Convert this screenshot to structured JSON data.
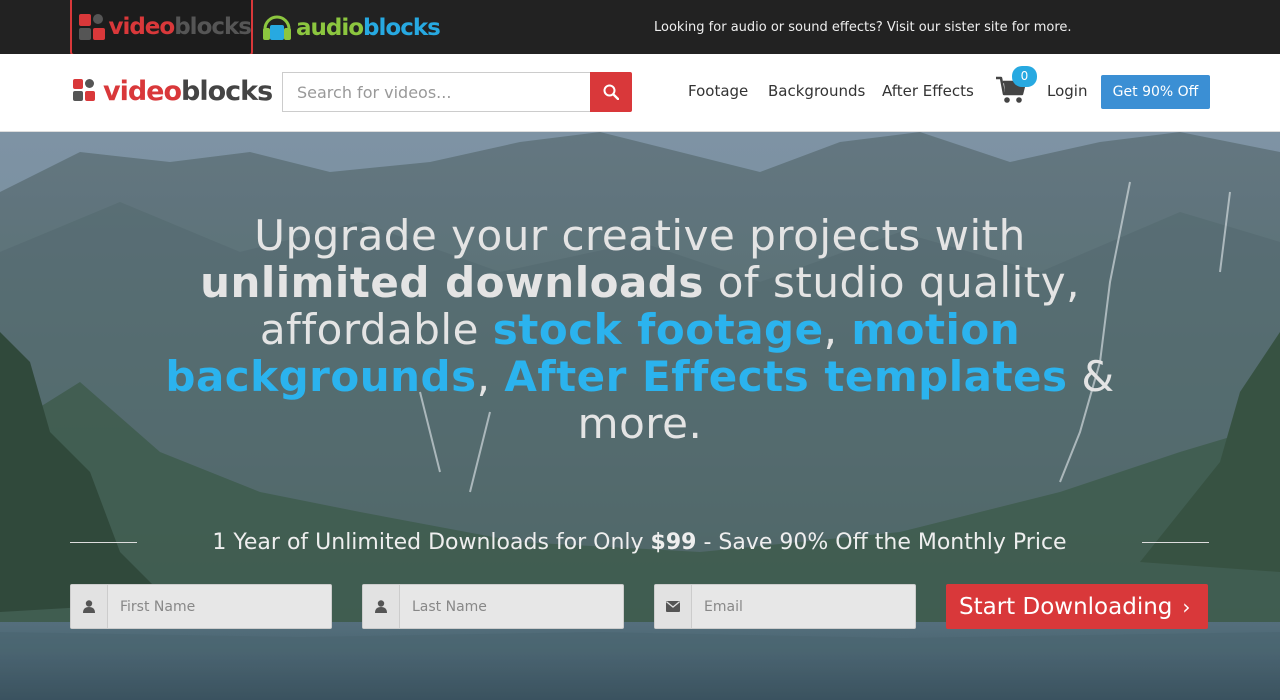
{
  "topbar": {
    "videoblocks_brand": {
      "word_video": "video",
      "word_blocks": "blocks"
    },
    "audioblocks_brand": {
      "word_audio": "audio",
      "word_blocks": "blocks"
    },
    "sister_message": "Looking for audio or sound effects? Visit our sister site for more."
  },
  "header": {
    "logo": {
      "word_video": "video",
      "word_blocks": "blocks"
    },
    "search": {
      "placeholder": "Search for videos...",
      "value": ""
    },
    "nav": [
      "Footage",
      "Backgrounds",
      "After Effects"
    ],
    "cart_count": "0",
    "login_label": "Login",
    "cta_label": "Get 90% Off"
  },
  "hero": {
    "headline": {
      "line1": "Upgrade your creative projects with",
      "bold_unlimited": "unlimited downloads",
      "line2_rest": " of studio quality,",
      "line3_start": "affordable ",
      "link_stock": "stock footage",
      "comma1": ",",
      "link_motion": "motion backgrounds",
      "comma2": ",",
      "link_ae": "After Effects templates",
      "ending": " & more."
    },
    "offer": {
      "prefix": "1 Year of Unlimited Downloads for Only ",
      "price": "$99",
      "suffix": " - Save 90% Off the Monthly Price"
    },
    "form": {
      "first_name_placeholder": "First Name",
      "last_name_placeholder": "Last Name",
      "email_placeholder": "Email",
      "submit_label": "Start Downloading",
      "submit_chevron": "›"
    }
  },
  "colors": {
    "brand_red": "#d9383a",
    "accent_blue": "#2bb3ee",
    "cta_blue": "#3b8fd4",
    "audio_green": "#8cc63f"
  },
  "icons": [
    "videoblocks-logo-icon",
    "audioblocks-headphones-icon",
    "search-icon",
    "cart-icon",
    "user-icon",
    "envelope-icon",
    "chevron-right-icon"
  ]
}
